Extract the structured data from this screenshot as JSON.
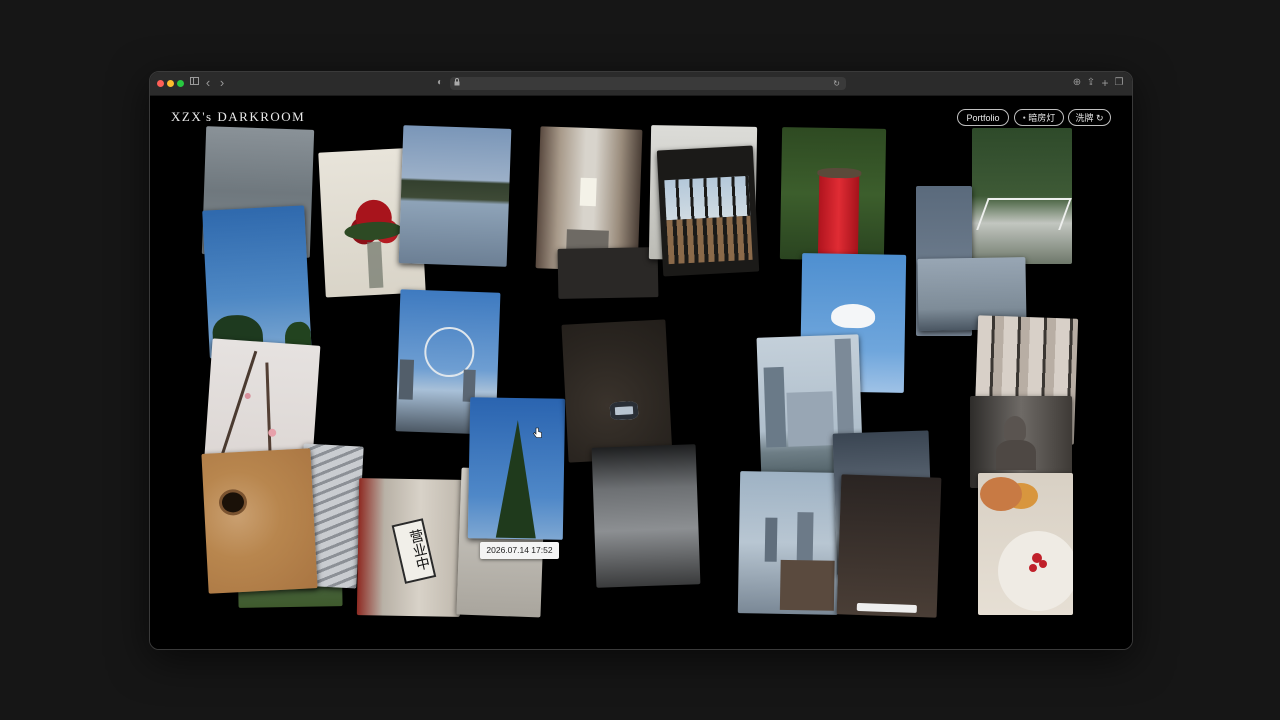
{
  "site": {
    "title": "XZX's DARKROOM"
  },
  "nav": {
    "portfolio": "Portfolio",
    "darkroom_light": "暗房灯",
    "shuffle": "洗牌"
  },
  "icons": {
    "sidebar": "sidebar-icon",
    "back": "chevron-left-icon",
    "forward": "chevron-right-icon",
    "privacy": "shield-icon",
    "lock": "lock-icon",
    "reload": "reload-icon",
    "share": "share-icon",
    "new_tab": "plus-icon",
    "tabs": "tabs-icon",
    "shuffle": "refresh-icon",
    "light_dot": "dot-icon",
    "cursor": "hand-pointer-icon"
  },
  "glyphs": {
    "back": "‹",
    "forward": "›",
    "privacy": "◐",
    "lock": "🔒",
    "reload": "↻",
    "share": "⇪",
    "new_tab": "+",
    "tabs": "❐",
    "shuffle": "↻",
    "light_dot": "●",
    "globe": "⊕"
  },
  "gallery": {
    "hover_timestamp": "2026.07.14 17:52",
    "sign_text": "营业中"
  },
  "colors": {
    "background": "#000000",
    "accent_red": "#c0202a",
    "sky_blue": "#3f78b5"
  }
}
